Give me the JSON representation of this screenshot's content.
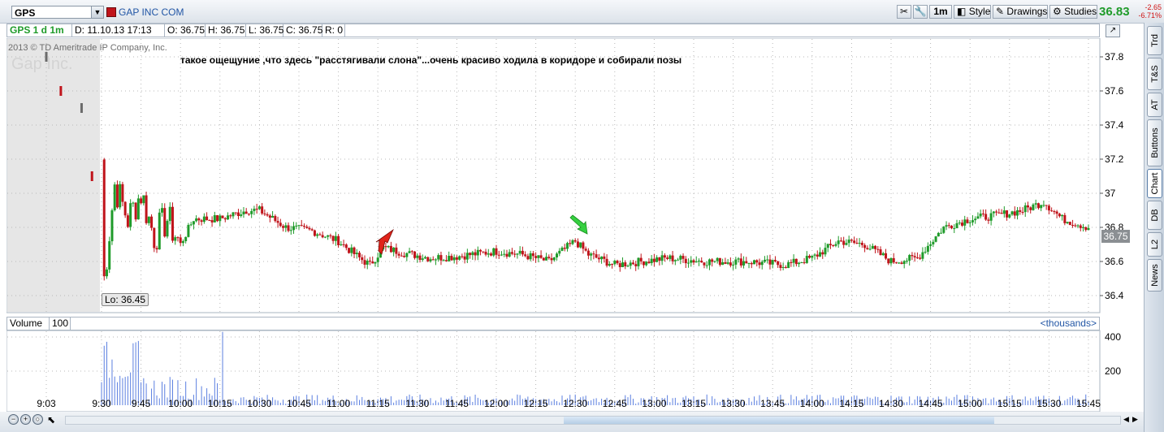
{
  "toolbar": {
    "symbol": "GPS",
    "company": "GAP INC COM",
    "interval": "1m",
    "style_label": "Style",
    "drawings_label": "Drawings",
    "studies_label": "Studies",
    "last_price": "36.83",
    "change": "-2.65",
    "change_pct": "-6.71%"
  },
  "infobar": {
    "chart_id": "GPS 1 d 1m",
    "date": "D: 11.10.13 17:13",
    "open": "O: 36.75",
    "high": "H: 36.75",
    "low": "L: 36.75",
    "close": "C: 36.75",
    "r": "R: 0"
  },
  "watermark": {
    "copyright": "2013 © TD Ameritrade IP Company, Inc.",
    "logo_text": "Gap Inc."
  },
  "annotation": "такое ощещуние ,что здесь \"расстягивали слона\"...очень красиво ходила в коридоре и собирали позы",
  "lo_label": "Lo: 36.45",
  "current_price_label": "36.75",
  "volume_panel": {
    "label": "Volume",
    "period": "100",
    "units": "<thousands>"
  },
  "side_tabs": [
    "Trd",
    "T&S",
    "AT",
    "Buttons",
    "Chart",
    "DB",
    "L2",
    "News"
  ],
  "chart_data": {
    "type": "candlestick",
    "price_ticks": [
      "37.8",
      "37.6",
      "37.4",
      "37.2",
      "37",
      "36.8",
      "36.6",
      "36.4"
    ],
    "volume_ticks": [
      "400",
      "200"
    ],
    "x_ticks": [
      "9:03",
      "9:30",
      "9:45",
      "10:00",
      "10:15",
      "10:30",
      "10:45",
      "11:00",
      "11:15",
      "11:30",
      "11:45",
      "12:00",
      "12:15",
      "12:30",
      "12:45",
      "13:00",
      "13:15",
      "13:30",
      "13:45",
      "14:00",
      "14:15",
      "14:30",
      "14:45",
      "15:00",
      "15:15",
      "15:30",
      "15:45"
    ],
    "ylim": [
      36.35,
      37.9
    ],
    "volume_ylim": [
      0,
      450
    ],
    "price_path": [
      [
        "9:30",
        37.2
      ],
      [
        "9:31",
        36.5
      ],
      [
        "9:35",
        37.05
      ],
      [
        "9:40",
        36.85
      ],
      [
        "9:45",
        37.0
      ],
      [
        "9:50",
        36.75
      ],
      [
        "9:55",
        36.85
      ],
      [
        "10:00",
        36.7
      ],
      [
        "10:05",
        36.85
      ],
      [
        "10:15",
        36.85
      ],
      [
        "10:25",
        36.9
      ],
      [
        "10:30",
        36.9
      ],
      [
        "10:40",
        36.8
      ],
      [
        "10:50",
        36.78
      ],
      [
        "11:00",
        36.72
      ],
      [
        "11:08",
        36.62
      ],
      [
        "11:12",
        36.58
      ],
      [
        "11:17",
        36.68
      ],
      [
        "11:25",
        36.65
      ],
      [
        "11:35",
        36.62
      ],
      [
        "11:45",
        36.63
      ],
      [
        "12:00",
        36.66
      ],
      [
        "12:10",
        36.64
      ],
      [
        "12:20",
        36.6
      ],
      [
        "12:30",
        36.72
      ],
      [
        "12:35",
        36.64
      ],
      [
        "12:45",
        36.58
      ],
      [
        "12:55",
        36.6
      ],
      [
        "13:05",
        36.62
      ],
      [
        "13:20",
        36.6
      ],
      [
        "13:35",
        36.6
      ],
      [
        "13:50",
        36.58
      ],
      [
        "14:00",
        36.62
      ],
      [
        "14:10",
        36.72
      ],
      [
        "14:20",
        36.7
      ],
      [
        "14:30",
        36.6
      ],
      [
        "14:40",
        36.62
      ],
      [
        "14:50",
        36.8
      ],
      [
        "15:00",
        36.85
      ],
      [
        "15:10",
        36.87
      ],
      [
        "15:20",
        36.9
      ],
      [
        "15:28",
        36.95
      ],
      [
        "15:35",
        36.85
      ],
      [
        "15:45",
        36.8
      ]
    ],
    "premarket": [
      [
        "9:03",
        37.8
      ],
      [
        "9:10",
        37.6
      ],
      [
        "9:20",
        37.5
      ],
      [
        "9:25",
        37.1
      ]
    ],
    "colors": {
      "up": "#1f9b2a",
      "down": "#c0141b"
    },
    "grid": true
  }
}
